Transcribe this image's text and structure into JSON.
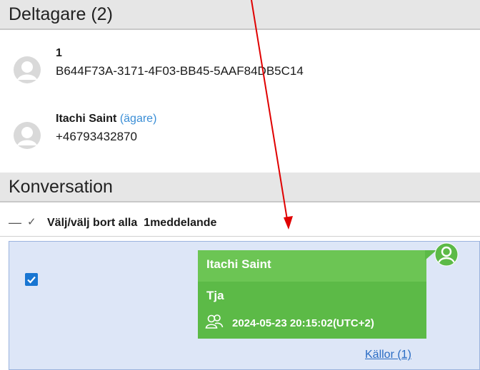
{
  "participants_section": {
    "title": "Deltagare (2)"
  },
  "participants": [
    {
      "name": "1",
      "role": "",
      "id": "B644F73A-3171-4F03-BB45-5AAF84DB5C14"
    },
    {
      "name": "Itachi Saint",
      "role": "(ägare)",
      "id": "+46793432870"
    }
  ],
  "conversation_section": {
    "title": "Konversation"
  },
  "toolbar": {
    "collapse": "—",
    "check": "✓",
    "label": "Välj/välj bort alla  1meddelande"
  },
  "message": {
    "checked": true,
    "sender": "Itachi Saint",
    "text": "Tja",
    "timestamp": "2024-05-23 20:15:02(UTC+2)",
    "sources_link": "Källor (1)"
  },
  "colors": {
    "bubble": "#5cba47",
    "bubble_header": "#6cc554",
    "selection_bg": "#dde6f7",
    "link": "#2a6cc4",
    "arrow": "#e00000"
  }
}
